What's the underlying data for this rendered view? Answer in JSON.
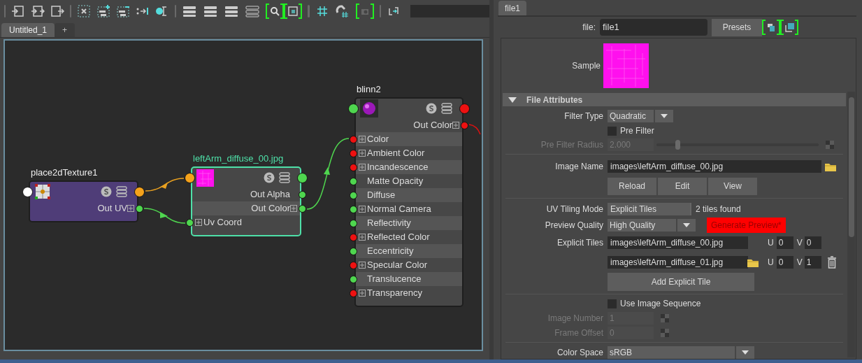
{
  "editor_tabs": [
    {
      "label": "Untitled_1",
      "selected": true
    },
    {
      "label": "+",
      "selected": false
    }
  ],
  "nodes": [
    {
      "title": "place2dTexture1",
      "kind": "placement",
      "selected": false,
      "in_port": {
        "color": "#ffffff"
      },
      "out_port": {
        "color": "#f5a21b"
      },
      "attributes": [
        {
          "label": "Out UV",
          "kind": "output",
          "expandable": true,
          "color": "#4fd64f"
        }
      ]
    },
    {
      "title": "leftArm_diffuse_00.jpg",
      "kind": "texture",
      "selected": true,
      "in_port": {
        "color": "#f5a21b"
      },
      "out_port": {
        "color": "#4fd64f"
      },
      "attributes": [
        {
          "label": "Out Alpha",
          "kind": "output",
          "expandable": false,
          "color": "#4fd64f"
        },
        {
          "label": "Out Color",
          "kind": "output",
          "expandable": true,
          "color": "#4fd64f"
        },
        {
          "label": "Uv Coord",
          "kind": "input",
          "expandable": true,
          "color": "#4fd64f"
        }
      ]
    },
    {
      "title": "blinn2",
      "kind": "shader",
      "selected": false,
      "in_port": {
        "color": "#4fd64f"
      },
      "out_port": {
        "color": "#ee1111"
      },
      "attributes": [
        {
          "label": "Out Color",
          "kind": "output",
          "expandable": true,
          "color": "#ee1111"
        },
        {
          "label": "Color",
          "kind": "input",
          "expandable": true,
          "color": "#ee1111"
        },
        {
          "label": "Ambient Color",
          "kind": "input",
          "expandable": true,
          "color": "#ee1111"
        },
        {
          "label": "Incandescence",
          "kind": "input",
          "expandable": true,
          "color": "#ee1111"
        },
        {
          "label": "Matte Opacity",
          "kind": "input",
          "expandable": false,
          "color": "#4fd64f"
        },
        {
          "label": "Diffuse",
          "kind": "input",
          "expandable": false,
          "color": "#4fd64f"
        },
        {
          "label": "Normal Camera",
          "kind": "input",
          "expandable": true,
          "color": "#4fd64f"
        },
        {
          "label": "Reflectivity",
          "kind": "input",
          "expandable": false,
          "color": "#4fd64f"
        },
        {
          "label": "Reflected Color",
          "kind": "input",
          "expandable": true,
          "color": "#ee1111"
        },
        {
          "label": "Eccentricity",
          "kind": "input",
          "expandable": false,
          "color": "#4fd64f"
        },
        {
          "label": "Specular Color",
          "kind": "input",
          "expandable": true,
          "color": "#ee1111"
        },
        {
          "label": "Translucence",
          "kind": "input",
          "expandable": false,
          "color": "#4fd64f"
        },
        {
          "label": "Transparency",
          "kind": "input",
          "expandable": true,
          "color": "#ee1111"
        }
      ]
    }
  ],
  "attribute_editor": {
    "tabs": [
      {
        "label": "file1",
        "selected": true
      }
    ],
    "node_label": "file:",
    "node_name": "file1",
    "presets": "Presets",
    "sample_label": "Sample",
    "section": {
      "title": "File Attributes",
      "expanded": true
    },
    "groups": [
      [
        {
          "kind": "dropdown",
          "label": "Filter Type",
          "value": "Quadratic"
        },
        {
          "kind": "checkbox",
          "label": "Pre Filter",
          "checked": false
        },
        {
          "kind": "slider",
          "label": "Pre Filter Radius",
          "value": "2.000",
          "disabled": true,
          "level": 0.12
        }
      ],
      [
        {
          "kind": "file_field",
          "label": "Image Name",
          "value": "images\\leftArm_diffuse_00.jpg"
        },
        {
          "kind": "buttons",
          "buttons": [
            "Reload",
            "Edit",
            "View"
          ]
        }
      ],
      [
        {
          "kind": "value_note",
          "label": "UV Tiling Mode",
          "value": "Explicit Tiles",
          "note": "2 tiles found"
        },
        {
          "kind": "dropdown",
          "label": "Preview Quality",
          "value": "High Quality",
          "button": {
            "label": "Generate Preview*",
            "highlighted": true
          }
        },
        {
          "kind": "tile",
          "label": "Explicit Tiles",
          "value": "images\\leftArm_diffuse_00.jpg",
          "u_label": "U",
          "u": "0",
          "v_label": "V",
          "v": "0",
          "removable": false
        },
        {
          "kind": "tile",
          "value": "images\\leftArm_diffuse_01.jpg",
          "u_label": "U",
          "u": "0",
          "v_label": "V",
          "v": "1",
          "removable": true
        },
        {
          "kind": "wide_button",
          "label": "Add Explicit Tile"
        }
      ],
      [
        {
          "kind": "checkbox",
          "label": "Use Image Sequence",
          "checked": false
        },
        {
          "kind": "number",
          "label": "Image Number",
          "value": "1",
          "disabled": true
        },
        {
          "kind": "number",
          "label": "Frame Offset",
          "value": "0",
          "disabled": true
        }
      ],
      [
        {
          "kind": "dropdown",
          "label": "Color Space",
          "value": "sRGB"
        }
      ]
    ]
  }
}
